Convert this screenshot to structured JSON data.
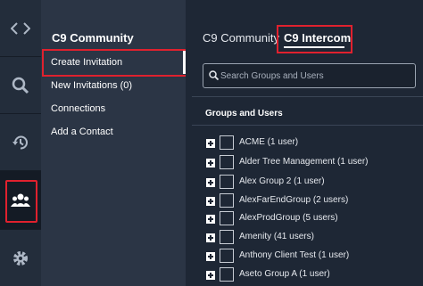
{
  "sidebar": {
    "icons": [
      "code-icon",
      "search-icon",
      "history-icon",
      "people-icon",
      "settings-icon"
    ]
  },
  "community_panel": {
    "title": "C9 Community",
    "items": [
      "Create Invitation",
      "New Invitations (0)",
      "Connections",
      "Add a Contact"
    ]
  },
  "main": {
    "tabs": [
      "C9 Community",
      "C9 Intercom"
    ],
    "search_placeholder": "Search Groups and Users",
    "section_title": "Groups and Users",
    "groups": [
      "ACME (1 user)",
      "Alder Tree Management (1 user)",
      "Alex Group 2 (1 user)",
      "AlexFarEndGroup (2 users)",
      "AlexProdGroup (5 users)",
      "Amenity (41 users)",
      "Anthony Client Test (1 user)",
      "Aseto Group A (1 user)"
    ]
  },
  "colors": {
    "highlight": "#e0212e",
    "rail_bg": "#232d3b",
    "panel_bg": "#2b3545",
    "main_bg": "#1e2735"
  }
}
